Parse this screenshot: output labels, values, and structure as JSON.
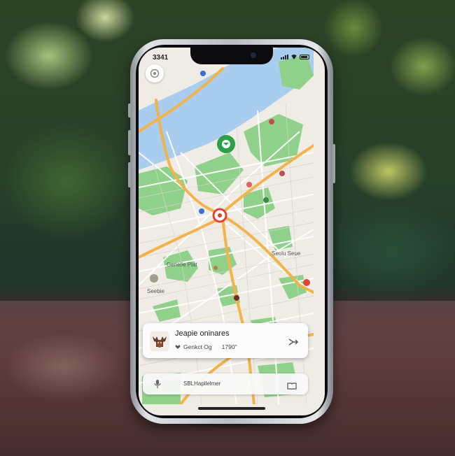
{
  "status_bar": {
    "time": "3341"
  },
  "map": {
    "labels": {
      "district": "Seolu Seue",
      "west_label": "Seebie",
      "park_label": "Genelie Plat"
    }
  },
  "place_card": {
    "title": "Jeapie oninares",
    "subtitle": "Genkct Og",
    "rating": "1790\""
  },
  "search_bar": {
    "text": "SBLHapllelmer"
  },
  "colors": {
    "water": "#a9cdee",
    "park": "#8fd08b",
    "road_major": "#f2b34b",
    "road_minor": "#ffffff",
    "pin_green": "#2aa04a",
    "pin_red": "#e04436"
  }
}
